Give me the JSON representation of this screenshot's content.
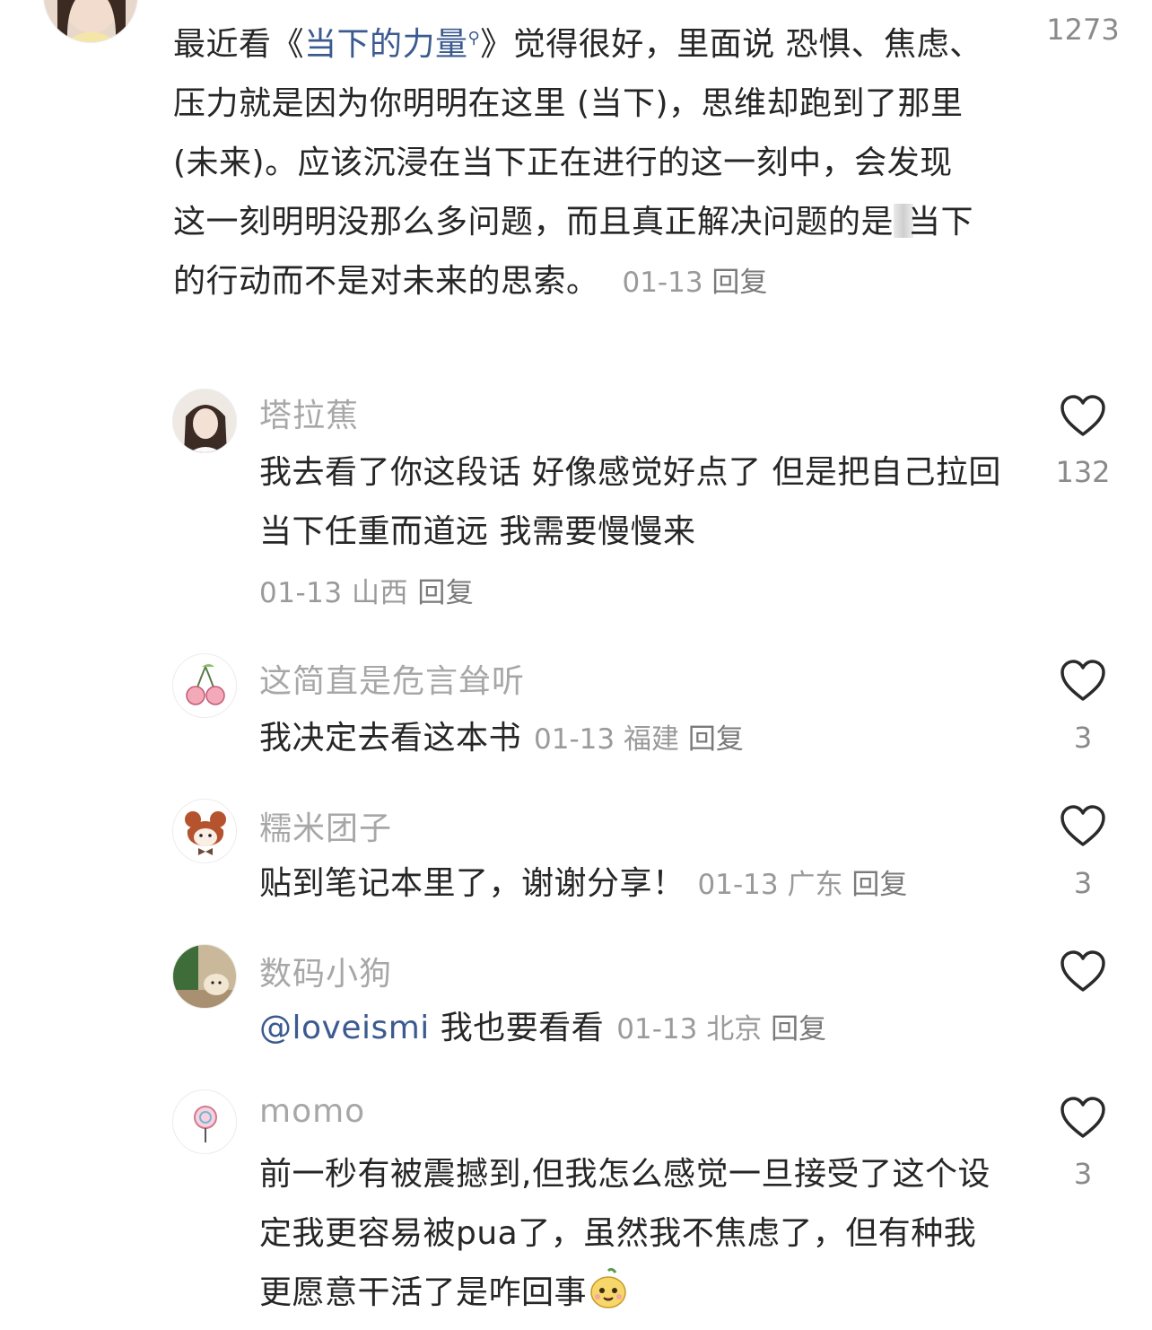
{
  "main_comment": {
    "text_before": "最近看《",
    "book_title": "当下的力量",
    "text_after": "》觉得很好，里面说 恐惧、焦虑、压力就是因为你明明在这里 (当下)，思维却跑到了那里 (未来)。应该沉浸在当下正在进行的这一刻中，会发现这一刻明明没那么多问题，而且真正解决问题的是",
    "text_after2": "当下的行动而不是对未来的思索。",
    "date": "01-13",
    "reply_label": "回复",
    "likes": "1273"
  },
  "replies": [
    {
      "username": "塔拉蕉",
      "text": "我去看了你这段话 好像感觉好点了 但是把自己拉回当下任重而道远 我需要慢慢来",
      "date": "01-13",
      "location": "山西",
      "reply_label": "回复",
      "likes": "132"
    },
    {
      "username": "这简直是危言耸听",
      "text": "我决定去看这本书",
      "date": "01-13",
      "location": "福建",
      "reply_label": "回复",
      "likes": "3"
    },
    {
      "username": "糯米团子",
      "text": "贴到笔记本里了，谢谢分享！",
      "date": "01-13",
      "location": "广东",
      "reply_label": "回复",
      "likes": "3"
    },
    {
      "username": "数码小狗",
      "mention": "@loveismi",
      "text": "我也要看看",
      "date": "01-13",
      "location": "北京",
      "reply_label": "回复",
      "likes": ""
    },
    {
      "username": "momo",
      "text": "前一秒有被震撼到,但我怎么感觉一旦接受了这个设定我更容易被pua了，虽然我不焦虑了，但有种我更愿意干活了是咋回事",
      "date": "",
      "location": "",
      "reply_label": "",
      "likes": "3"
    }
  ],
  "colors": {
    "text": "#262626",
    "username": "#a7a7a7",
    "meta": "#9a9a9a",
    "link": "#3b5a8f"
  },
  "icons": {
    "like": "heart-outline-icon",
    "search_hint": "search-icon",
    "emoji": "smiling-face-emoji"
  }
}
